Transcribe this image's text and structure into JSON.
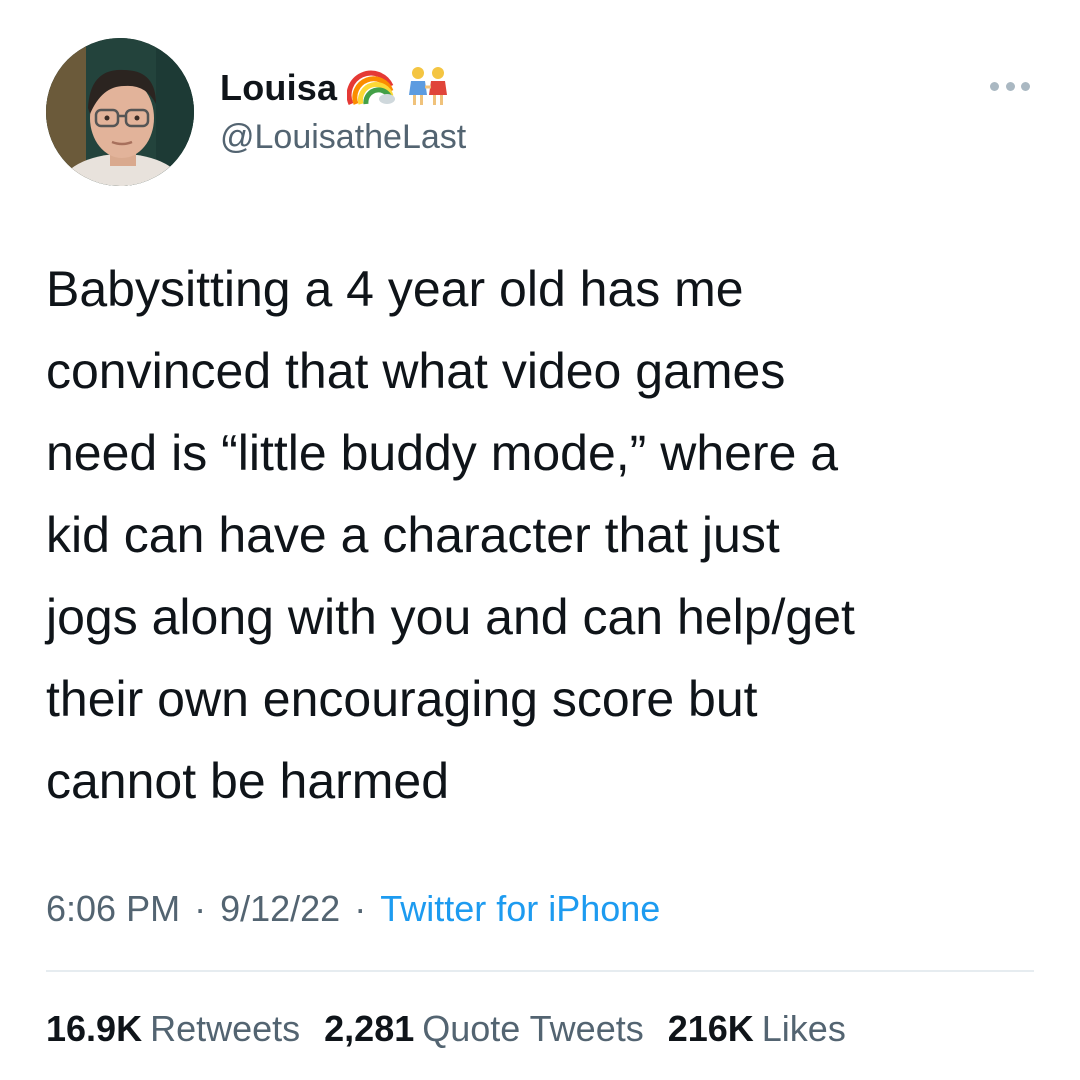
{
  "author": {
    "display_name": "Louisa",
    "handle": "@LouisatheLast",
    "name_emojis": [
      "rainbow-icon",
      "two-women-holding-hands-icon"
    ]
  },
  "tweet": {
    "text": "Babysitting a 4 year old has me\nconvinced that what video games\nneed is “little buddy mode,” where a\nkid can have a character that just\njogs along with you and can help/get\ntheir own encouraging score but\ncannot be harmed",
    "time": "6:06 PM",
    "date": "9/12/22",
    "separator": "·",
    "source": "Twitter for iPhone"
  },
  "stats": {
    "retweets_count": "16.9K",
    "retweets_label": "Retweets",
    "quotes_count": "2,281",
    "quotes_label": "Quote Tweets",
    "likes_count": "216K",
    "likes_label": "Likes"
  },
  "colors": {
    "text": "#0f1419",
    "secondary": "#536471",
    "link": "#1d9bf0",
    "divider": "#e6ecf0"
  }
}
